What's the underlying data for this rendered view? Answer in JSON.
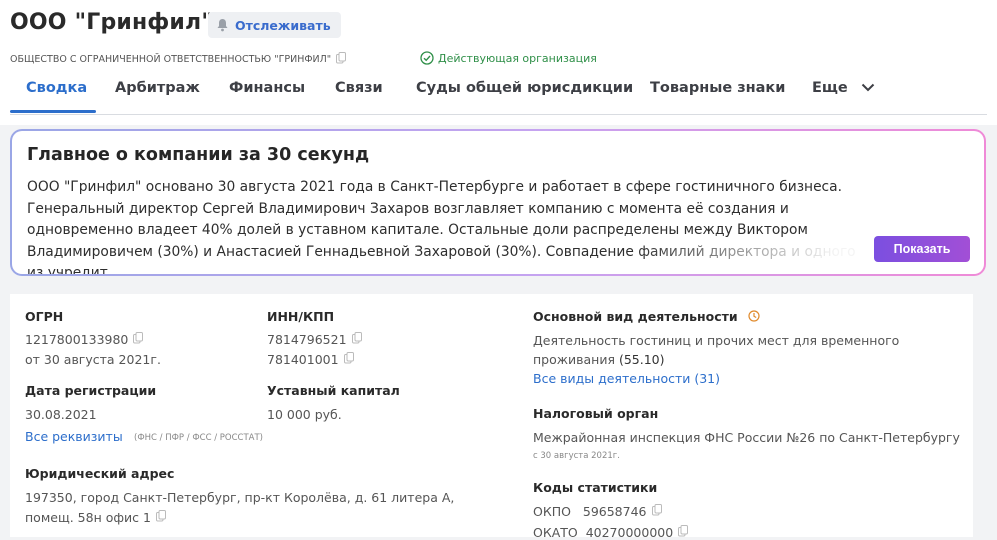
{
  "header": {
    "company_name": "ООО \"Гринфил\"",
    "follow_label": "Отслеживать",
    "full_name": "ОБЩЕСТВО С ОГРАНИЧЕННОЙ ОТВЕТСТВЕННОСТЬЮ \"ГРИНФИЛ\"",
    "status": "Действующая организация",
    "status_color": "#2f8f48"
  },
  "tabs": [
    {
      "label": "Сводка",
      "active": true
    },
    {
      "label": "Арбитраж"
    },
    {
      "label": "Финансы"
    },
    {
      "label": "Связи"
    },
    {
      "label": "Суды общей юрисдикции"
    },
    {
      "label": "Товарные знаки"
    },
    {
      "label": "Еще"
    }
  ],
  "summary": {
    "title": "Главное о компании за 30 секунд",
    "text": "ООО \"Гринфил\" основано 30 августа 2021 года в Санкт-Петербурге и работает в сфере гостиничного бизнеса. Генеральный директор Сергей Владимирович Захаров возглавляет компанию с момента её создания и одновременно владеет 40% долей в уставном капитале. Остальные доли распределены между Виктором Владимировичем (30%) и Анастасией Геннадьевной Захаровой (30%). Совпадение фамилий директора и одного из учредит",
    "show_label": "Показать"
  },
  "requisites": {
    "ogrn_label": "ОГРН",
    "ogrn": "1217800133980",
    "ogrn_date": "от 30 августа 2021г.",
    "inn_label": "ИНН/КПП",
    "inn": "7814796521",
    "kpp": "781401001",
    "reg_label": "Дата регистрации",
    "reg_date": "30.08.2021",
    "capital_label": "Уставный капитал",
    "capital": "10 000 руб.",
    "all_link": "Все реквизиты",
    "all_sources": "(ФНС / ПФР / ФСС / РОССТАТ)",
    "address_label": "Юридический адрес",
    "address_line1": "197350, город Санкт-Петербург, пр-кт Королёва, д. 61 литера А,",
    "address_line2": "помещ. 58н офис 1"
  },
  "activity": {
    "label": "Основной вид деятельности",
    "line1": "Деятельность гостиниц и прочих мест для временного",
    "line2": "проживания",
    "code": "(55.10)",
    "all_link": "Все виды деятельности (31)"
  },
  "tax": {
    "label": "Налоговый орган",
    "name": "Межрайонная инспекция ФНС России №26 по Санкт-Петербургу",
    "since": "с 30 августа 2021г."
  },
  "stats": {
    "label": "Коды статистики",
    "okpo_label": "ОКПО",
    "okpo": "59658746",
    "okato_label": "ОКАТО",
    "okato": "40270000000"
  }
}
